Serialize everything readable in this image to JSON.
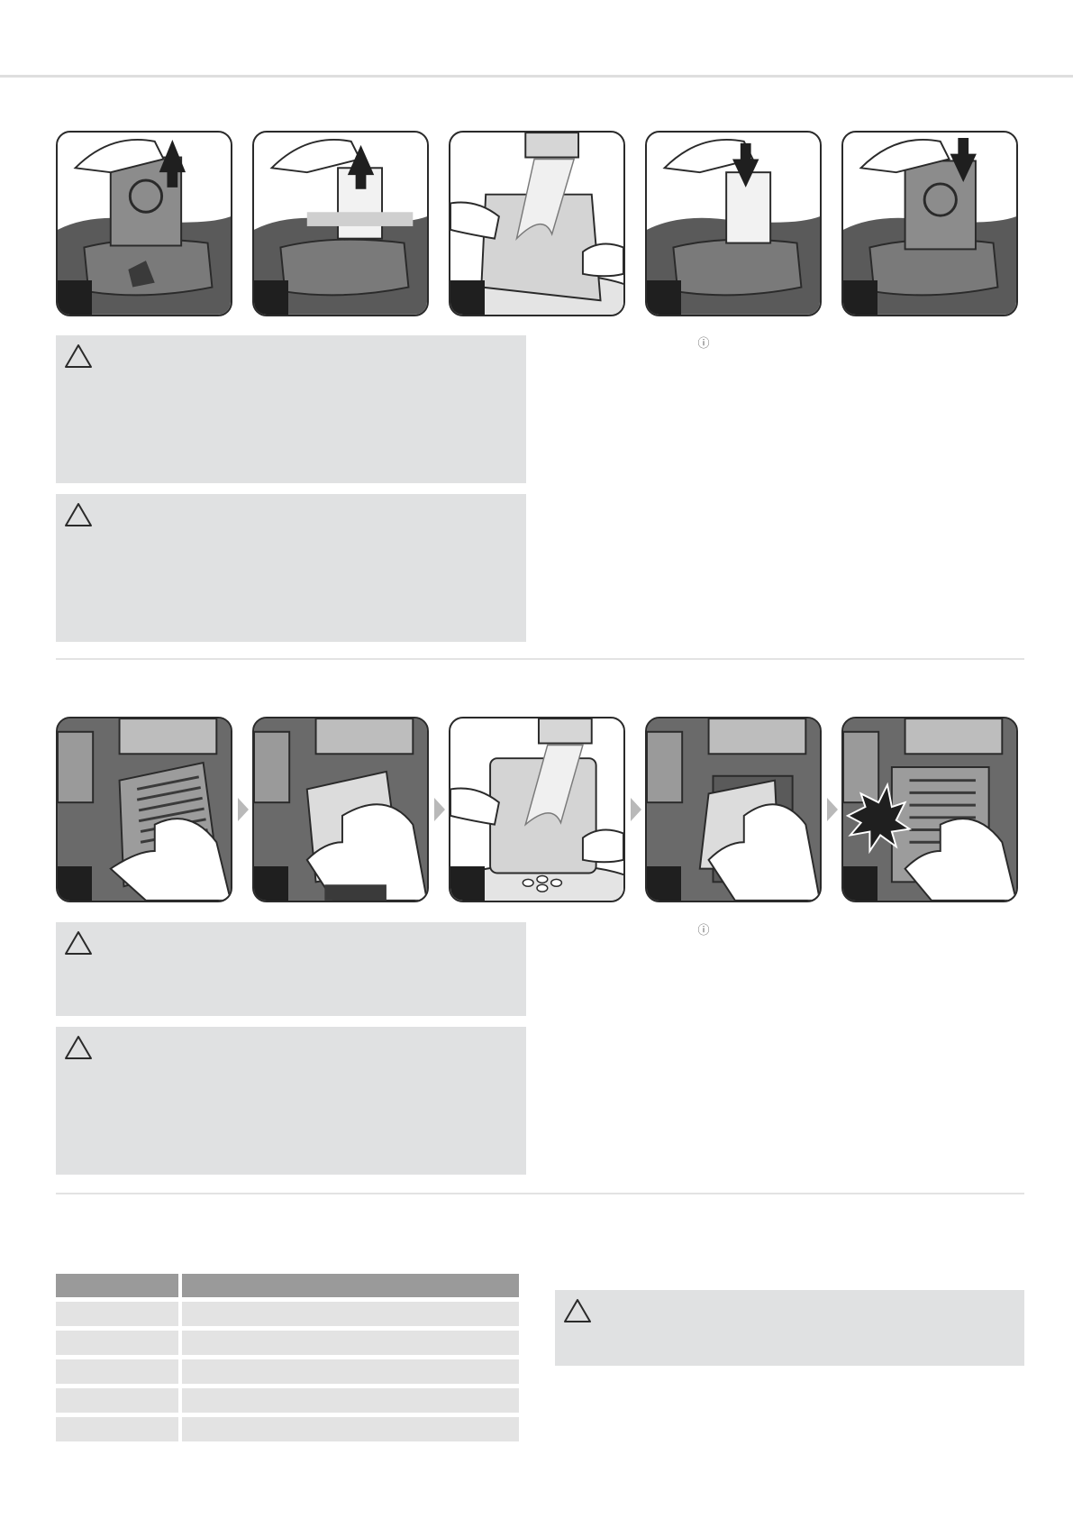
{
  "section1": {
    "steps": [
      {
        "name": "remove-bag",
        "direction": "up"
      },
      {
        "name": "remove-motor-filter",
        "direction": "up"
      },
      {
        "name": "rinse-motor-filter",
        "direction": "none"
      },
      {
        "name": "insert-motor-filter",
        "direction": "down"
      },
      {
        "name": "insert-bag",
        "direction": "down"
      }
    ],
    "warnings": 2,
    "info_icon": "ⓘ"
  },
  "section2": {
    "steps": [
      {
        "name": "open-exhaust-grille"
      },
      {
        "name": "remove-exhaust-filter"
      },
      {
        "name": "rinse-exhaust-filter"
      },
      {
        "name": "insert-exhaust-filter"
      },
      {
        "name": "close-exhaust-grille"
      }
    ],
    "warnings": 2,
    "info_icon": "ⓘ"
  },
  "section3": {
    "table": {
      "header": [
        "",
        ""
      ],
      "rows": [
        [
          "",
          ""
        ],
        [
          "",
          ""
        ],
        [
          "",
          ""
        ],
        [
          "",
          ""
        ],
        [
          "",
          ""
        ]
      ]
    },
    "warnings": 1
  },
  "colors": {
    "box_bg": "#e0e1e2",
    "table_header": "#9a9a9a",
    "table_row": "#e3e3e3",
    "illustration_dark": "#2a2a2a",
    "illustration_mid": "#8a8a8a"
  },
  "icons": [
    "warning-triangle-icon",
    "info-icon",
    "arrow-up-icon",
    "arrow-down-icon",
    "chevron-right-icon"
  ]
}
